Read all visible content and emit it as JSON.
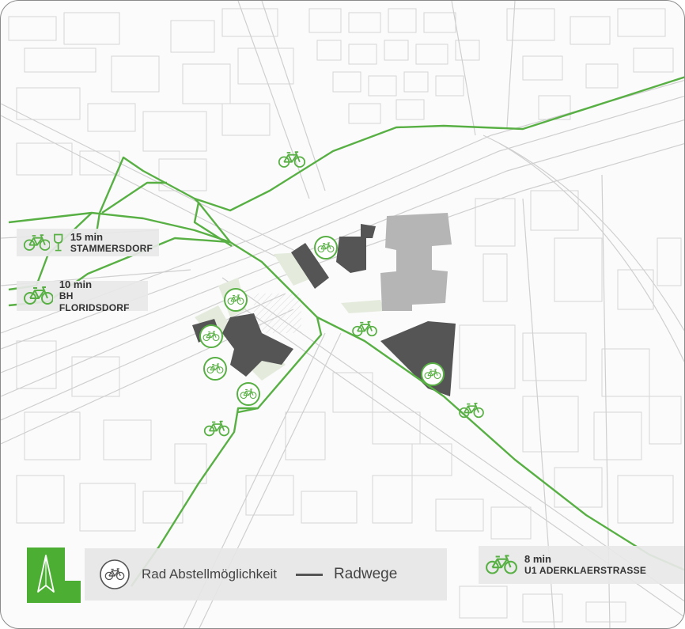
{
  "colors": {
    "route": "#58b044",
    "building_dark": "#555555",
    "building_grey": "#b4b4b4",
    "green_area": "#e3eadc",
    "accent": "#4caf33"
  },
  "destinations": [
    {
      "time": "15 min",
      "place": "STAMMERSDORF",
      "icons": [
        "bicycle-icon",
        "wine-glass-icon"
      ]
    },
    {
      "time": "10 min",
      "place": "BH FLORIDSDORF",
      "icons": [
        "bicycle-icon"
      ]
    },
    {
      "time": "8 min",
      "place": "U1 ADERKLAERSTRASSE",
      "icons": [
        "bicycle-icon"
      ]
    }
  ],
  "legend": {
    "parking_label": "Rad Abstellmöglichkeit",
    "route_label": "Radwege",
    "north_icon": "north-arrow-icon"
  }
}
